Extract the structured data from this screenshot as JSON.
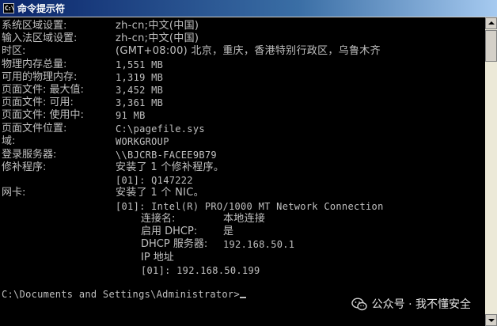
{
  "window": {
    "title": "命令提示符",
    "icon_label": "C:\\",
    "colors": {
      "titlebar": "#0a246a",
      "console_bg": "#000000",
      "console_fg": "#c0c0c0"
    }
  },
  "rows": [
    {
      "label": "系统区域设置:",
      "value": "zh-cn;中文(中国)"
    },
    {
      "label": "输入法区域设置:",
      "value": "zh-cn;中文(中国)"
    },
    {
      "label": "时区:",
      "value": "(GMT+08:00) 北京，重庆，香港特别行政区，乌鲁木齐"
    },
    {
      "label": "物理内存总量:",
      "value": "1,551 MB"
    },
    {
      "label": "可用的物理内存:",
      "value": "1,319 MB"
    },
    {
      "label": "页面文件: 最大值:",
      "value": "3,452 MB"
    },
    {
      "label": "页面文件: 可用:",
      "value": "3,361 MB"
    },
    {
      "label": "页面文件: 使用中:",
      "value": "91 MB"
    },
    {
      "label": "页面文件位置:",
      "value": "C:\\pagefile.sys"
    },
    {
      "label": "域:",
      "value": "WORKGROUP"
    },
    {
      "label": "登录服务器:",
      "value": "\\\\BJCRB-FACEE9B79"
    },
    {
      "label": "修补程序:",
      "value": "安装了 1 个修补程序。"
    },
    {
      "label": "",
      "value": "[01]: Q147222"
    },
    {
      "label": "网卡:",
      "value": "安装了 1 个 NIC。"
    },
    {
      "label": "",
      "value": "[01]: Intel(R) PRO/1000 MT Network Connection"
    }
  ],
  "nic_details": [
    {
      "label": "连接名:",
      "value": "本地连接"
    },
    {
      "label": "启用 DHCP:",
      "value": "是"
    },
    {
      "label": "DHCP 服务器:",
      "value": "192.168.50.1"
    },
    {
      "label": "IP 地址",
      "value": ""
    },
    {
      "label": "",
      "value": "[01]: 192.168.50.199"
    }
  ],
  "prompt": "C:\\Documents and Settings\\Administrator>",
  "watermark": {
    "icon": "wechat-icon",
    "text": "公众号 · 我不懂安全"
  }
}
